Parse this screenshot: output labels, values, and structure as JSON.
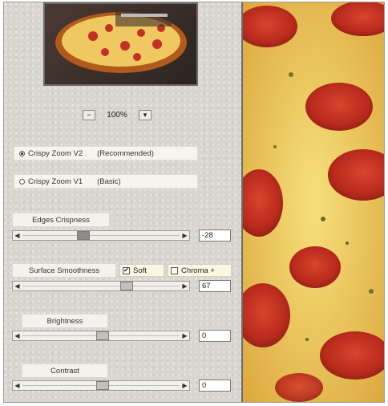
{
  "preview": {
    "zoom_value": "100%"
  },
  "mode": {
    "v2_label": "Crispy Zoom V2",
    "v2_desc": "(Recommended)",
    "v1_label": "Crispy Zoom V1",
    "v1_desc": "(Basic)",
    "selected": "v2"
  },
  "edges": {
    "label": "Edges Crispness",
    "value": "-28"
  },
  "surface": {
    "label": "Surface Smoothness",
    "soft_label": "Soft",
    "soft_checked": true,
    "chroma_label": "Chroma +",
    "chroma_checked": false,
    "value": "67"
  },
  "brightness": {
    "label": "Brightness",
    "value": "0"
  },
  "contrast": {
    "label": "Contrast",
    "value": "0"
  },
  "icons": [
    "zoom-out-icon",
    "zoom-in-icon",
    "left-arrow-icon",
    "right-arrow-icon"
  ],
  "colors": {
    "panel_bg": "#d9d6d0",
    "preview_bg": "#e8c25a"
  }
}
